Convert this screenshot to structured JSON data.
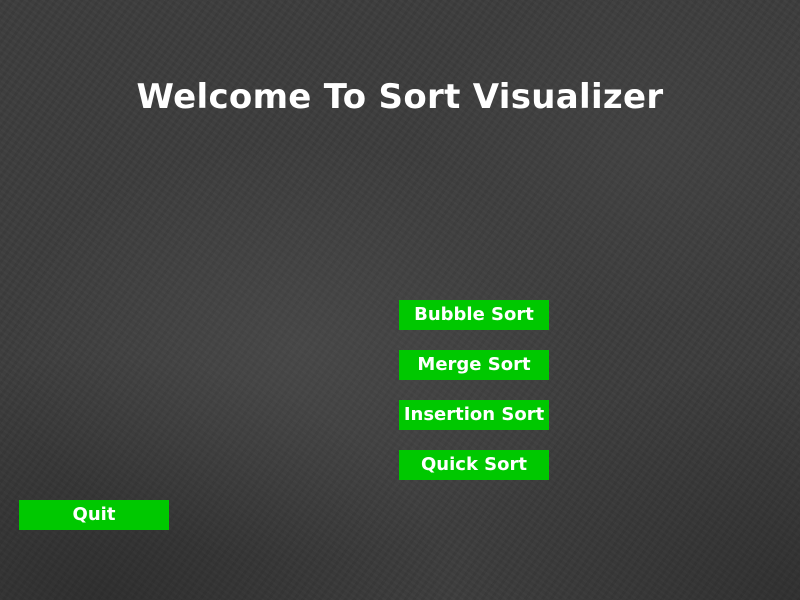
{
  "title": "Welcome To Sort Visualizer",
  "menu": {
    "bubble_sort": "Bubble Sort",
    "merge_sort": "Merge Sort",
    "insertion_sort": "Insertion Sort",
    "quick_sort": "Quick Sort"
  },
  "quit_label": "Quit",
  "colors": {
    "button_background": "#00c800",
    "button_text": "#ffffff",
    "title_text": "#ffffff",
    "background": "#3d3d3d"
  }
}
